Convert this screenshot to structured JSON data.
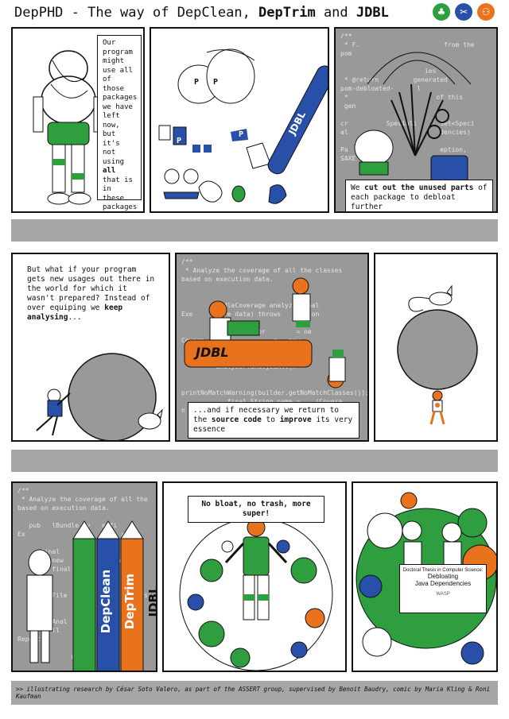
{
  "header": {
    "title_prefix": "DepPHD - The way of DepClean, ",
    "title_deptrim": "DepTrim",
    "title_and": " and ",
    "title_jdbl": "JDBL",
    "logos": [
      {
        "name": "depclean-logo",
        "color": "#2e9e3e",
        "glyph": "♣"
      },
      {
        "name": "deptrim-logo",
        "color": "#2850a8",
        "glyph": "✂"
      },
      {
        "name": "jdbl-logo",
        "color": "#e8731c",
        "glyph": "⚇"
      }
    ]
  },
  "panel1": {
    "caption": "Our program might use all of those packages we have left now, but it's not using",
    "caption_bold": "all",
    "caption_end": "that is in these packages"
  },
  "panel2": {
    "bag_letters": [
      "P",
      "P",
      "P",
      "P"
    ],
    "scanner_label": "JDBL"
  },
  "panel3": {
    "code": "/**\n * F.                      from the\npom\n\n                      ies\n * @return         generated\npom-debloated-      l\n *                       of this\n gen\n\ncr          Speciali      Set<Speci\nal                        dencies)\n\nPa                        eption,\nSAXE",
    "caption_pre": "We ",
    "caption_bold": "cut out the unused parts",
    "caption_post": " of each package to debloat further"
  },
  "panel4": {
    "caption": "But what if your program gets new usages out there in the world for which it wasn't prepared? Instead of over equiping we",
    "caption_bold": "keep analysing",
    "caption_end": "..."
  },
  "panel5": {
    "code": "/**\n * Analyze the coverage of all the classes\nbased on execution data.\n\n                    \n           dleCoverage analyze(final\nExe       ore data) throws    eption\n\n               Builder        = ne\nCovera                  r = new\n\n\n         analyzer.analyzeAll(f\n\n\nprintNoMatchWarning(builder.getNoMatchClasses());\n            final String name =    (Covera\nn",
    "scanner_label": "JDBL",
    "caption_pre": "...and if necessary we return to the ",
    "caption_bold1": "source code",
    "caption_mid": " to ",
    "caption_bold2": "improve",
    "caption_post": " its very essence"
  },
  "panel7": {
    "code": "/**\n * Analyze the coverage of all the\nbased on execution data.\n\n   pub   lBundle ov   e(fi\nEx                         xce\n\n      final                lder\n         new              n\n         final                new\n\n\n         File                Files\n\n\n         Anal                 tch\n         ll                   n C\nReport                        ssi\n\n   }          urn            me)\n\n}",
    "markers": [
      {
        "label": "DepClean",
        "color": "#2e9e3e"
      },
      {
        "label": "DepTrim",
        "color": "#2850a8"
      },
      {
        "label": "JDBL",
        "color": "#e8731c"
      }
    ]
  },
  "panel8": {
    "caption": "No bloat, no trash, more super!"
  },
  "panel9": {
    "poster_line1": "Doctoral Thesis in Computer Science:",
    "poster_line2": "Debloating",
    "poster_line3": "Java Dependencies",
    "poster_sponsor": "WASP"
  },
  "footer": {
    "text": ">> illustrating research by César Soto Valero, as part of the ASSERT group, supervised by Benoit Baudry, comic by Maria Kling & Roni Kaufman"
  },
  "colors": {
    "green": "#2e9e3e",
    "blue": "#2850a8",
    "orange": "#e8731c",
    "panel_gray": "#999999",
    "band_gray": "#a6a6a6"
  }
}
